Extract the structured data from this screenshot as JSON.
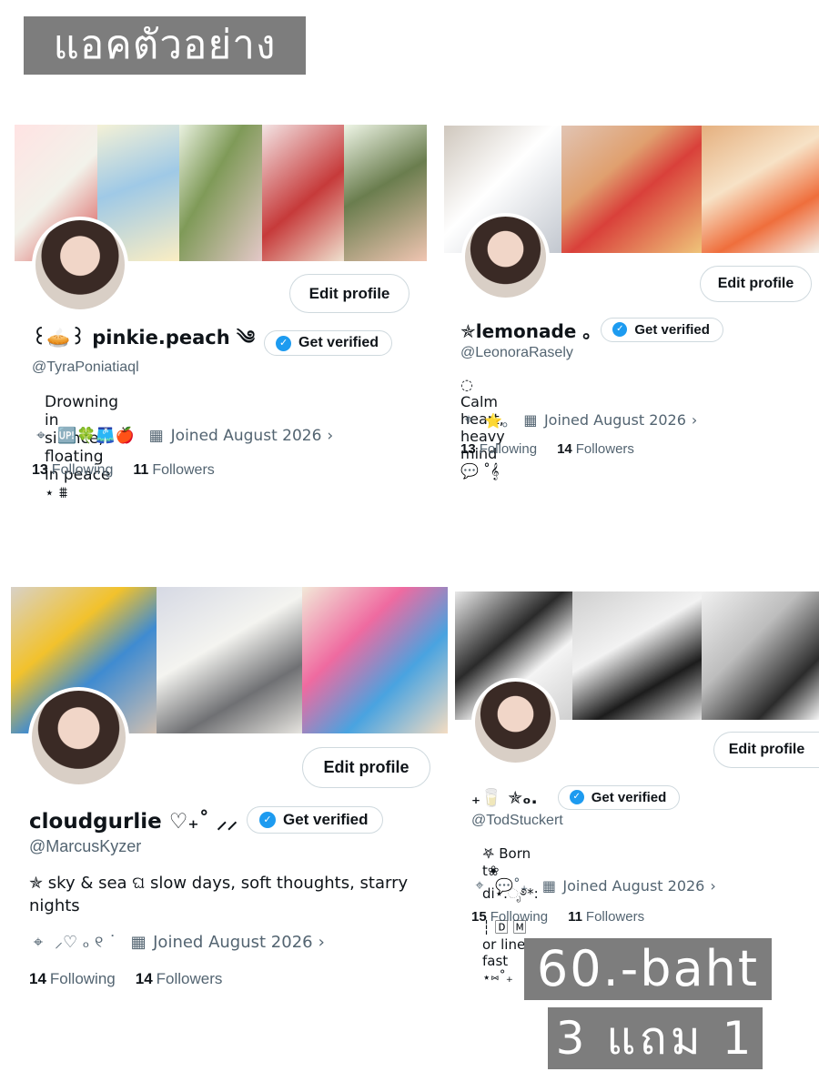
{
  "header_label": "แอคตัวอย่าง",
  "colors": {
    "verified_blue": "#1d9bf0",
    "muted_text": "#536471",
    "label_bg": "#7d7d7d"
  },
  "icons": {
    "location": "location-pin-icon",
    "calendar": "calendar-icon",
    "verified": "verified-badge-icon",
    "chevron": "chevron-right-icon"
  },
  "profiles": [
    {
      "name": "꒰🥧꒱ pinkie.peach ༄",
      "verify_label": "Get verified",
      "handle": "@TyraPoniatiaql",
      "bio": "Drowning in silence, floating in peace ⋆ ⩩",
      "location": "🆙🍀🩳🍎",
      "joined": "Joined August 2026",
      "following_count": "13",
      "following_label": "Following",
      "followers_count": "11",
      "followers_label": "Followers",
      "edit_label": "Edit profile"
    },
    {
      "name": "✯lemonade ｡",
      "verify_label": "Get verified",
      "handle": "@LeonoraRasely",
      "bio": "◌ Calm heart, heavy mind 💬 ˚𝄞",
      "location": "⭐｡",
      "joined": "Joined August 2026",
      "following_count": "13",
      "following_label": "Following",
      "followers_count": "14",
      "followers_label": "Followers",
      "edit_label": "Edit profile"
    },
    {
      "name": "cloudgurlie ♡₊˚ ⸝⸝",
      "verify_label": "Get verified",
      "handle": "@MarcusKyzer",
      "bio": "✯ sky & sea ଘ slow days, soft thoughts, starry nights",
      "location": "⸝♡ ₒ ୧ ˙",
      "joined": "Joined August 2026",
      "following_count": "14",
      "following_label": "Following",
      "followers_count": "14",
      "followers_label": "Followers",
      "edit_label": "Edit profile"
    },
    {
      "name": "₊🥛 ✯ₒ.",
      "verify_label": "Get verified",
      "handle": "@TodStuckert",
      "bio": "𖤐 Born t❀ di⋆.ೃ࿔*: ┆ 🄳 🄼 or line fast ⋆⑅˚₊",
      "location": "💬˚₊",
      "joined": "Joined August 2026",
      "following_count": "15",
      "following_label": "Following",
      "followers_count": "11",
      "followers_label": "Followers",
      "edit_label": "Edit profile"
    }
  ],
  "price_label": "60.-baht",
  "promo_label": "3 แถม 1"
}
